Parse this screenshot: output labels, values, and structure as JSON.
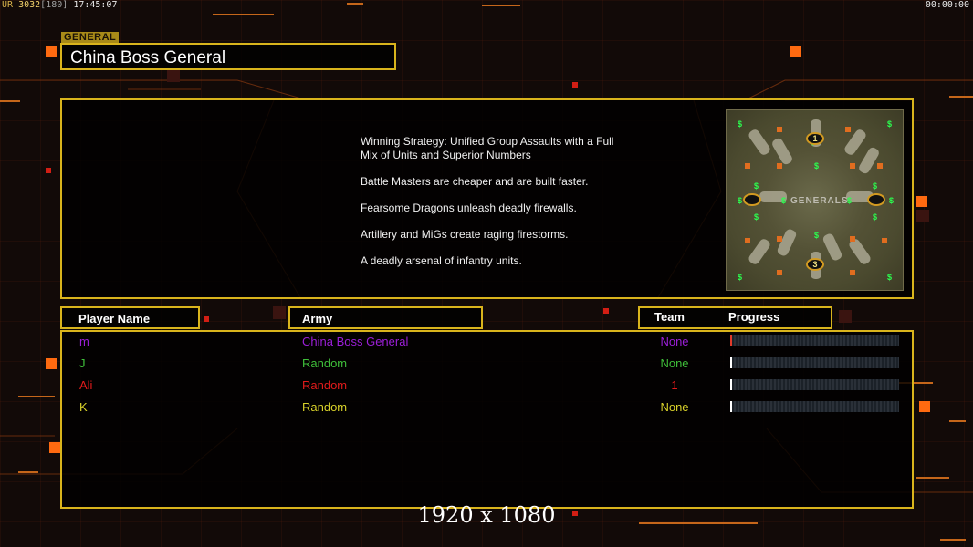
{
  "hud": {
    "ur_label": "UR",
    "fps": "30",
    "fps2": "32",
    "max": "[180]",
    "clock": "17:45:07",
    "timer": "00:00:00"
  },
  "general_tag": "GENERAL",
  "title": "China Boss General",
  "strategy": [
    "Winning Strategy: Unified Group Assaults with a Full\n Mix of Units and Superior Numbers",
    "Battle Masters are cheaper and are built faster.",
    "Fearsome Dragons unleash deadly firewalls.",
    "Artillery and MiGs create raging firestorms.",
    "A deadly arsenal of infantry units."
  ],
  "map": {
    "label": "GENERALS",
    "spawns": [
      "1",
      "3"
    ]
  },
  "headers": {
    "player_name": "Player Name",
    "army": "Army",
    "team": "Team",
    "progress": "Progress"
  },
  "players": [
    {
      "name": "m",
      "army": "China Boss General",
      "team": "None",
      "progress": 0.01,
      "color": "#9b1fd8",
      "bar": "#e23b2b"
    },
    {
      "name": "J",
      "army": "Random",
      "team": "None",
      "progress": 0.01,
      "color": "#3fbf3a",
      "bar": "#ffffff"
    },
    {
      "name": "Ali",
      "army": "Random",
      "team": "1",
      "progress": 0.01,
      "color": "#e21b1b",
      "bar": "#ffffff"
    },
    {
      "name": "K",
      "army": "Random",
      "team": "None",
      "progress": 0.01,
      "color": "#d9d22a",
      "bar": "#ffffff"
    }
  ],
  "resolution": "1920 x 1080",
  "colors": {
    "accent": "#d9b41c",
    "background": "#120a08"
  }
}
